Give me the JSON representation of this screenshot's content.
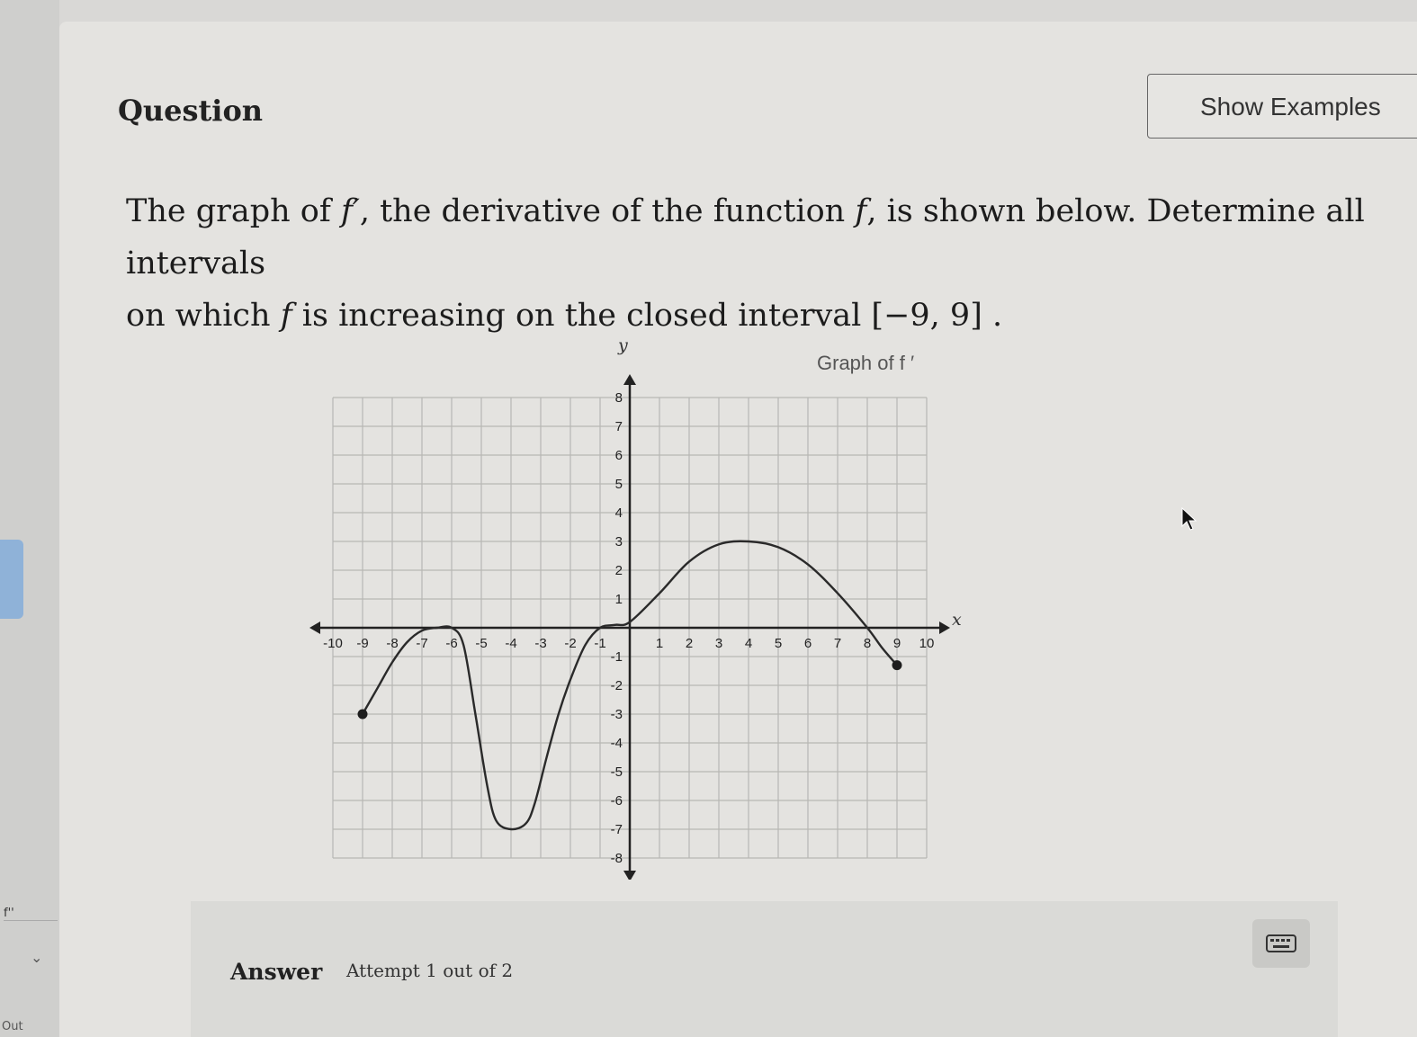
{
  "sidebar": {
    "fpp_label": "f''",
    "chevron": "⌄",
    "out_label": "Out"
  },
  "question": {
    "heading": "Question",
    "show_examples_label": "Show Examples",
    "text_parts": {
      "p1": "The graph of ",
      "fprime": "f′",
      "p2": ", the derivative of the function ",
      "f1": "f",
      "p3": ", is shown below. Determine all intervals",
      "p4": "on which ",
      "f2": "f",
      "p5": " is increasing on the closed interval ",
      "interval": "[−9, 9]",
      "p6": " ."
    }
  },
  "chart_data": {
    "type": "line",
    "title": "Graph of f ′",
    "xlabel": "x",
    "ylabel": "y",
    "xlim": [
      -10,
      10
    ],
    "ylim": [
      -8,
      8
    ],
    "grid": true,
    "x_ticks": [
      "-10",
      "-9",
      "-8",
      "-7",
      "-6",
      "-5",
      "-4",
      "-3",
      "-2",
      "-1",
      "1",
      "2",
      "3",
      "4",
      "5",
      "6",
      "7",
      "8",
      "9",
      "10"
    ],
    "y_ticks": [
      "8",
      "7",
      "6",
      "5",
      "4",
      "3",
      "2",
      "1",
      "-1",
      "-2",
      "-3",
      "-4",
      "-5",
      "-6",
      "-7",
      "-8"
    ],
    "series": [
      {
        "x": [
          -9,
          -8.5,
          -8,
          -7.5,
          -7,
          -6.5,
          -6,
          -5.6,
          -5.2,
          -4.8,
          -4.5,
          -4,
          -3.5,
          -3.2,
          -2.8,
          -2.4,
          -2,
          -1.5,
          -1,
          -0.5,
          0,
          1,
          2,
          3,
          4,
          5,
          6,
          7,
          8,
          8.5,
          9
        ],
        "y": [
          -3,
          -2.1,
          -1.2,
          -0.5,
          -0.1,
          0,
          0,
          -0.6,
          -3.0,
          -5.5,
          -6.7,
          -7,
          -6.8,
          -6.1,
          -4.5,
          -3.0,
          -1.8,
          -0.6,
          0,
          0.1,
          0.2,
          1.2,
          2.3,
          2.9,
          3,
          2.8,
          2.2,
          1.2,
          0,
          -0.7,
          -1.3
        ],
        "endpoints": [
          {
            "x": -9,
            "y": -3
          },
          {
            "x": 9,
            "y": -1.3
          }
        ]
      }
    ]
  },
  "answer": {
    "label": "Answer",
    "attempt": "Attempt 1 out of 2",
    "keyboard_icon": "keyboard-icon"
  }
}
